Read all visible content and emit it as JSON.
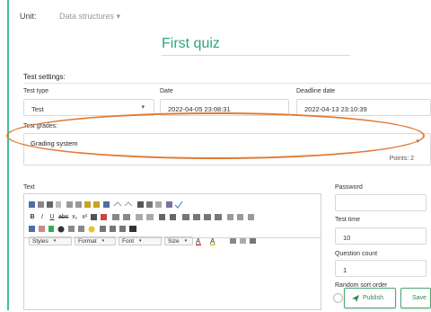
{
  "unit": {
    "label": "Unit:",
    "value": "Data structures",
    "caret": "▾"
  },
  "title": "First quiz",
  "settings": {
    "heading": "Test settings:",
    "test_type": {
      "label": "Test type",
      "value": "Test",
      "caret": "▾"
    },
    "date": {
      "label": "Date",
      "value": "2022-04-05 23:08:31"
    },
    "deadline": {
      "label": "Deadline date",
      "value": "2022-04-13 23:10:39"
    },
    "grades": {
      "label": "Test grades:",
      "value": "Grading system",
      "caret": "▾",
      "points": "Points: 2"
    }
  },
  "editor": {
    "label": "Text",
    "row2": [
      "B",
      "I",
      "U",
      "abc",
      "x₂",
      "x²"
    ],
    "styles": "Styles",
    "format": "Format",
    "font": "Font",
    "size": "Size",
    "dd_caret": "▾"
  },
  "side": {
    "password": {
      "label": "Password",
      "value": ""
    },
    "test_time": {
      "label": "Test time",
      "value": "10"
    },
    "question_count": {
      "label": "Question count",
      "value": "1"
    },
    "random_sort": {
      "label": "Random sort order"
    }
  },
  "buttons": {
    "publish": "Publish",
    "save": "Save"
  },
  "colors": {
    "accent": "#2fa57f",
    "highlight": "#e07b35",
    "button": "#2f8a52"
  }
}
